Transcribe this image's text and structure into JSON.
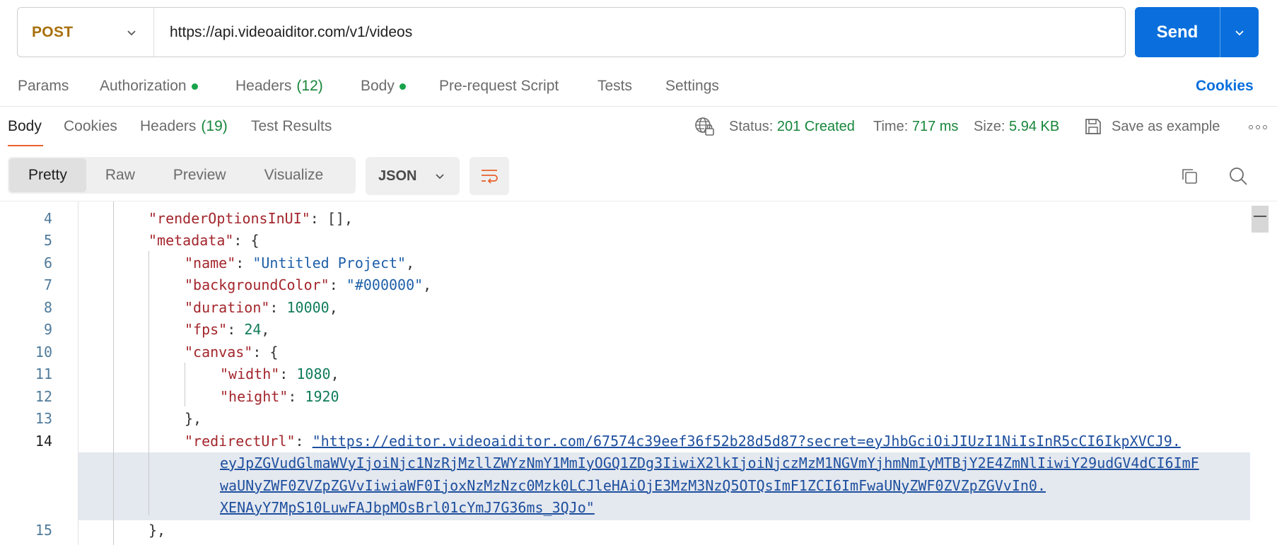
{
  "request": {
    "method": "POST",
    "url": "https://api.videoaiditor.com/v1/videos",
    "send_label": "Send"
  },
  "request_tabs": [
    {
      "label": "Params"
    },
    {
      "label": "Authorization",
      "dot": true
    },
    {
      "label": "Headers",
      "count": "(12)"
    },
    {
      "label": "Body",
      "dot": true
    },
    {
      "label": "Pre-request Script"
    },
    {
      "label": "Tests"
    },
    {
      "label": "Settings"
    }
  ],
  "cookies_link": "Cookies",
  "response_tabs": [
    {
      "label": "Body",
      "active": true
    },
    {
      "label": "Cookies"
    },
    {
      "label": "Headers",
      "count": "(19)"
    },
    {
      "label": "Test Results"
    }
  ],
  "response_meta": {
    "status_label": "Status:",
    "status_value": "201 Created",
    "time_label": "Time:",
    "time_value": "717 ms",
    "size_label": "Size:",
    "size_value": "5.94 KB",
    "save_label": "Save as example"
  },
  "view_modes": [
    {
      "label": "Pretty",
      "active": true
    },
    {
      "label": "Raw"
    },
    {
      "label": "Preview"
    },
    {
      "label": "Visualize"
    }
  ],
  "format": "JSON",
  "code_lines": [
    {
      "num": "4",
      "key": "\"renderOptionsInUI\"",
      "rest": ": [],"
    },
    {
      "num": "5",
      "key": "\"metadata\"",
      "rest": ": {"
    },
    {
      "num": "6",
      "key": "\"name\"",
      "rest": ": ",
      "str": "\"Untitled Project\"",
      "tail": ","
    },
    {
      "num": "7",
      "key": "\"backgroundColor\"",
      "rest": ": ",
      "str": "\"#000000\"",
      "tail": ","
    },
    {
      "num": "8",
      "key": "\"duration\"",
      "rest": ": ",
      "num_val": "10000",
      "tail": ","
    },
    {
      "num": "9",
      "key": "\"fps\"",
      "rest": ": ",
      "num_val": "24",
      "tail": ","
    },
    {
      "num": "10",
      "key": "\"canvas\"",
      "rest": ": {"
    },
    {
      "num": "11",
      "key": "\"width\"",
      "rest": ": ",
      "num_val": "1080",
      "tail": ","
    },
    {
      "num": "12",
      "key": "\"height\"",
      "rest": ": ",
      "num_val": "1920"
    },
    {
      "num": "13",
      "plain": "},"
    },
    {
      "num": "14",
      "key": "\"redirectUrl\"",
      "rest": ": "
    },
    {
      "num": "15",
      "plain": "},"
    }
  ],
  "redirect_url_lines": [
    "\"https://editor.videoaiditor.com/67574c39eef36f52b28d5d87?secret=eyJhbGciOiJIUzI1NiIsInR5cCI6IkpXVCJ9.",
    "eyJpZGVudGlmaWVyIjoiNjc1NzRjMzllZWYzNmY1MmIyOGQ1ZDg3IiwiX2lkIjoiNjczMzM1NGVmYjhmNmIyMTBjY2E4ZmNlIiwiY29udGV4dCI6ImF",
    "waUNyZWF0ZVZpZGVvIiwiaWF0IjoxNzMzNzc0Mzk0LCJleHAiOjE3MzM3NzQ5OTQsImF1ZCI6ImFwaUNyZWF0ZVZpZGVvIn0.",
    "XENAyY7MpS10LuwFAJbpMOsBrl01cYmJ7G36ms_3QJo\""
  ],
  "icons": {
    "method_chevron": "chevron-down-icon",
    "send_dropdown": "chevron-down-icon",
    "globe": "globe-lock-icon",
    "save": "floppy-disk-icon",
    "more": "more-horizontal-icon",
    "wrap": "wrap-lines-icon",
    "copy": "copy-icon",
    "search": "search-icon"
  },
  "colors": {
    "accent": "#0a6fdc",
    "method": "#a8700b",
    "success": "#17863a",
    "active_tab_underline": "#e8612c"
  }
}
